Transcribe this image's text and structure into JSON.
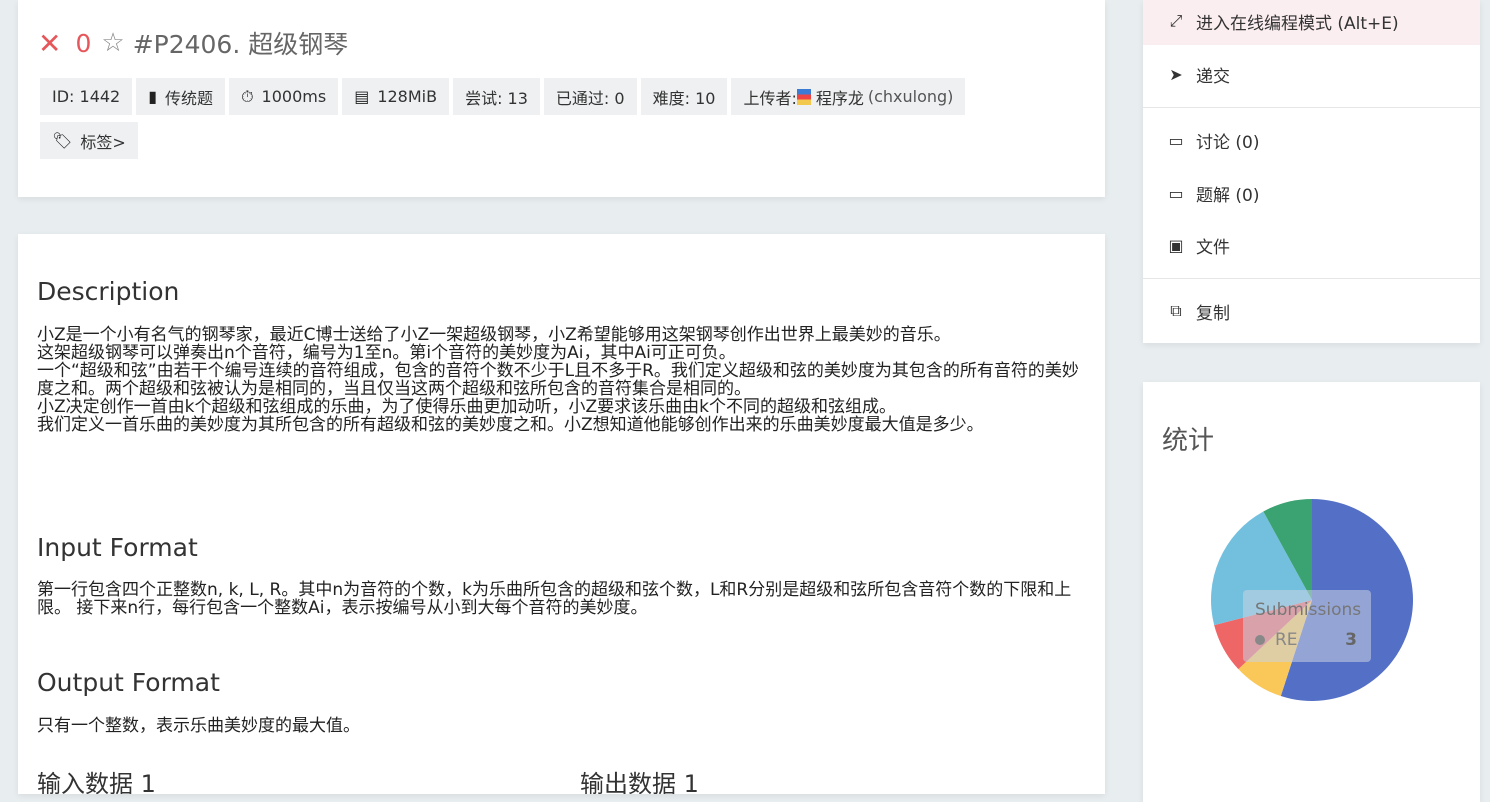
{
  "problem": {
    "status_icon": "close-icon",
    "score": "0",
    "star_icon": "star-outline-icon",
    "title": "#P2406. 超级钢琴"
  },
  "meta_tags": {
    "id": "ID: 1442",
    "type": "传统题",
    "time": "1000ms",
    "memory": "128MiB",
    "tries": "尝试: 13",
    "passed": "已通过: 0",
    "difficulty": "难度: 10",
    "uploader_label": "上传者:",
    "uploader_name": "程序龙",
    "uploader_handle": "(chxulong)",
    "labels": "标签>"
  },
  "description": {
    "heading": "Description",
    "lines": [
      "小Z是一个小有名气的钢琴家，最近C博士送给了小Z一架超级钢琴，小Z希望能够用这架钢琴创作出世界上最美妙的音乐。",
      "这架超级钢琴可以弹奏出n个音符，编号为1至n。第i个音符的美妙度为Ai，其中Ai可正可负。",
      "一个“超级和弦”由若干个编号连续的音符组成，包含的音符个数不少于L且不多于R。我们定义超级和弦的美妙度为其包含的所有音符的美妙度之和。两个超级和弦被认为是相同的，当且仅当这两个超级和弦所包含的音符集合是相同的。",
      "小Z决定创作一首由k个超级和弦组成的乐曲，为了使得乐曲更加动听，小Z要求该乐曲由k个不同的超级和弦组成。",
      "我们定义一首乐曲的美妙度为其所包含的所有超级和弦的美妙度之和。小Z想知道他能够创作出来的乐曲美妙度最大值是多少。"
    ]
  },
  "input_format": {
    "heading": "Input Format",
    "text": "第一行包含四个正整数n, k, L, R。其中n为音符的个数，k为乐曲所包含的超级和弦个数，L和R分别是超级和弦所包含音符个数的下限和上限。 接下来n行，每行包含一个整数Ai，表示按编号从小到大每个音符的美妙度。"
  },
  "output_format": {
    "heading": "Output Format",
    "text": "只有一个整数，表示乐曲美妙度的最大值。"
  },
  "samples": {
    "input_heading": "输入数据 1",
    "output_heading": "输出数据 1"
  },
  "sidebar": {
    "items": [
      {
        "label": "进入在线编程模式 (Alt+E)",
        "icon": "expand-icon"
      },
      {
        "label": "递交",
        "icon": "send-icon"
      },
      {
        "label": "讨论 (0)",
        "icon": "comment-icon"
      },
      {
        "label": "题解 (0)",
        "icon": "comment-icon"
      },
      {
        "label": "文件",
        "icon": "file-image-icon"
      },
      {
        "label": "复制",
        "icon": "copy-icon"
      }
    ]
  },
  "stats": {
    "title": "统计",
    "tooltip": {
      "title": "Submissions",
      "series_label": "RE",
      "value": "3"
    }
  },
  "chart_data": {
    "type": "pie",
    "slices": [
      {
        "name": "",
        "value": 55,
        "color": "#5470c6"
      },
      {
        "name": "",
        "value": 8,
        "color": "#fac858"
      },
      {
        "name": "RE",
        "value": 8,
        "color": "#ee6666"
      },
      {
        "name": "",
        "value": 21,
        "color": "#73c0de"
      },
      {
        "name": "",
        "value": 8,
        "color": "#3ba272"
      }
    ]
  }
}
